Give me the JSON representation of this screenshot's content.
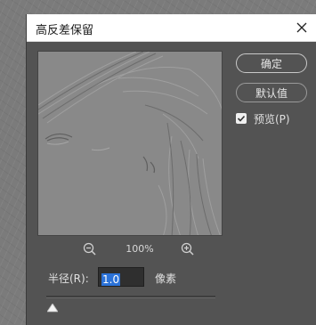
{
  "dialog": {
    "title": "高反差保留",
    "close_icon": "close-icon"
  },
  "preview": {
    "zoom_level": "100%",
    "zoom_out_icon": "zoom-out-icon",
    "zoom_in_icon": "zoom-in-icon"
  },
  "buttons": {
    "ok_label": "确定",
    "default_label": "默认值"
  },
  "preview_option": {
    "label": "预览(P)",
    "checked": true
  },
  "radius": {
    "label": "半径(R):",
    "value": "1.0",
    "unit": "像素",
    "slider_fraction": 0.0
  }
}
